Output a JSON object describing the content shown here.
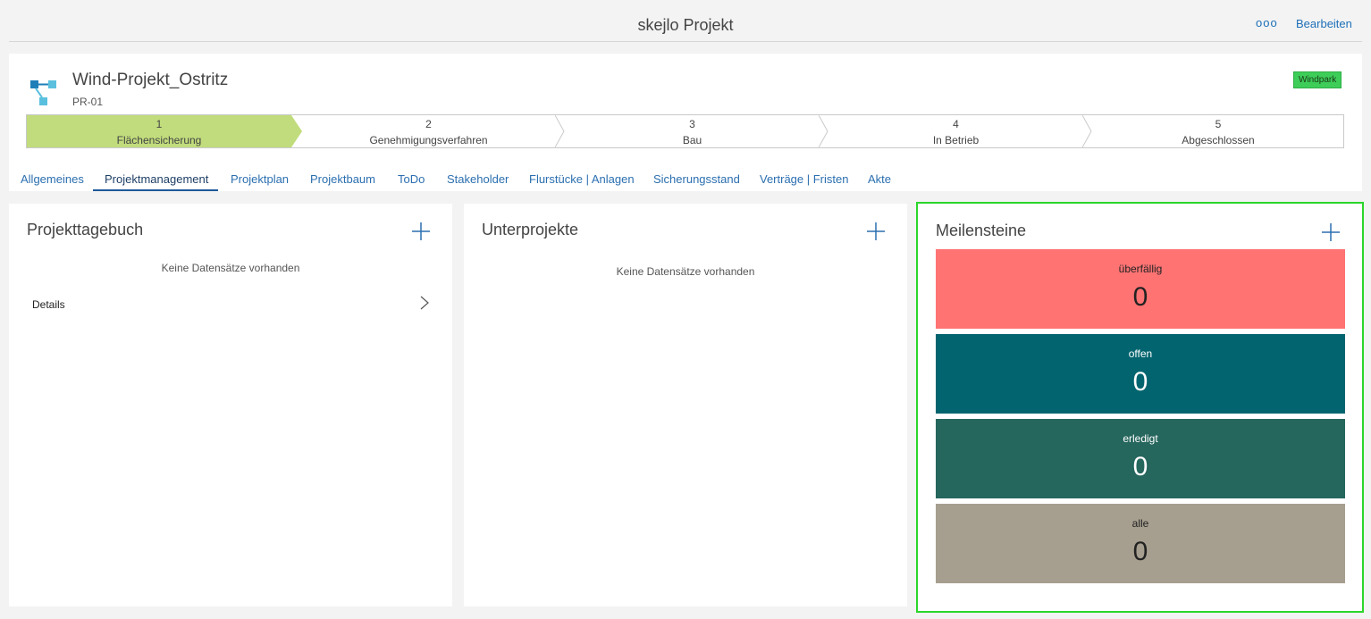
{
  "topbar": {
    "title": "skejlo Projekt",
    "more_label": "ooo",
    "edit_label": "Bearbeiten"
  },
  "project": {
    "name": "Wind-Projekt_Ostritz",
    "code": "PR-01",
    "tag": "Windpark",
    "tag_color": "#3dcd58"
  },
  "phases": [
    {
      "num": "1",
      "label": "Flächensicherung",
      "active": true
    },
    {
      "num": "2",
      "label": "Genehmigungsverfahren",
      "active": false
    },
    {
      "num": "3",
      "label": "Bau",
      "active": false
    },
    {
      "num": "4",
      "label": "In Betrieb",
      "active": false
    },
    {
      "num": "5",
      "label": "Abgeschlossen",
      "active": false
    }
  ],
  "tabs": [
    "Allgemeines",
    "Projektmanagement",
    "Projektplan",
    "Projektbaum",
    "ToDo",
    "Stakeholder",
    "Flurstücke | Anlagen",
    "Sicherungsstand",
    "Verträge | Fristen",
    "Akte"
  ],
  "active_tab": "Projektmanagement",
  "cards": {
    "tagebuch": {
      "title": "Projekttagebuch",
      "empty": "Keine Datensätze vorhanden",
      "details": "Details"
    },
    "unterprojekte": {
      "title": "Unterprojekte",
      "empty": "Keine Datensätze vorhanden"
    },
    "meilensteine": {
      "title": "Meilensteine",
      "tiles": [
        {
          "label": "überfällig",
          "value": "0",
          "color": "#ff7373"
        },
        {
          "label": "offen",
          "value": "0",
          "color": "#02646e"
        },
        {
          "label": "erledigt",
          "value": "0",
          "color": "#25665d"
        },
        {
          "label": "alle",
          "value": "0",
          "color": "#a69f8f"
        }
      ]
    }
  }
}
